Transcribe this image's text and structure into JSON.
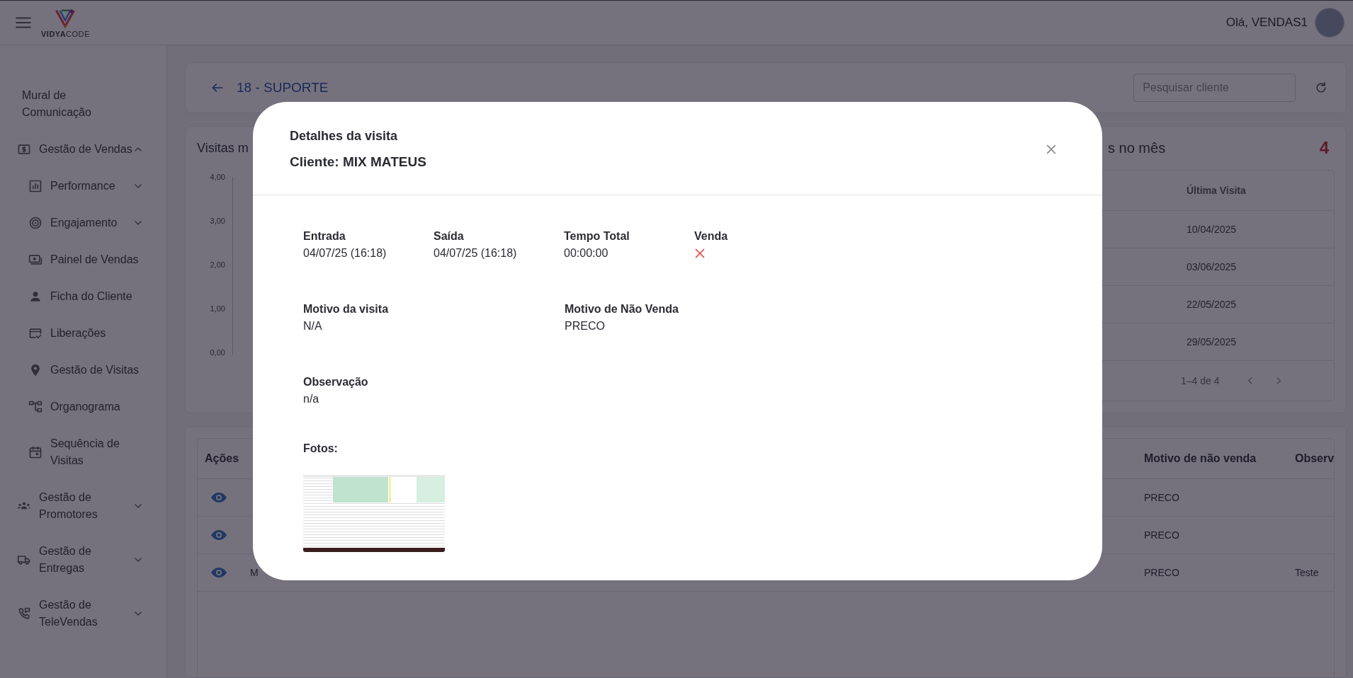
{
  "header": {
    "logo_text": "**VIDYA**CODE",
    "greeting": "Olá, VENDAS1"
  },
  "sidebar": {
    "items": [
      {
        "kind": "link",
        "label": "Mural de Comunicação"
      },
      {
        "kind": "group",
        "label": "Gestão de Vendas",
        "expanded": true,
        "children": [
          {
            "kind": "group",
            "label": "Performance",
            "expanded": false
          },
          {
            "kind": "group",
            "label": "Engajamento",
            "expanded": false
          },
          {
            "kind": "link",
            "label": "Painel de Vendas"
          },
          {
            "kind": "link",
            "label": "Ficha do Cliente"
          },
          {
            "kind": "link",
            "label": "Liberações"
          },
          {
            "kind": "link",
            "label": "Gestão de Visitas"
          },
          {
            "kind": "link",
            "label": "Organograma"
          },
          {
            "kind": "link",
            "label": "Sequência de Visitas"
          }
        ]
      },
      {
        "kind": "group",
        "label": "Gestão de Promotores",
        "expanded": false
      },
      {
        "kind": "group",
        "label": "Gestão de Entregas",
        "expanded": false
      },
      {
        "kind": "group",
        "label": "Gestão de TeleVendas",
        "expanded": false
      }
    ]
  },
  "page": {
    "title": "18 - SUPORTE",
    "search": {
      "placeholder": "Pesquisar cliente"
    }
  },
  "visits_card": {
    "chart_title": "Visitas m",
    "chart_yticks": [
      "4,00",
      "3,00",
      "2,00",
      "1,00",
      "0,00"
    ],
    "panel_title": "s no mês",
    "panel_count": "4",
    "table": {
      "columns": [
        "Última Visita"
      ],
      "rows": [
        [
          "10/04/2025"
        ],
        [
          "03/06/2025"
        ],
        [
          "22/05/2025"
        ],
        [
          "29/05/2025"
        ]
      ]
    },
    "pagination": "1–4 de 4"
  },
  "visits_table": {
    "columns": {
      "actions": "Ações",
      "reason": "Motivo de não venda",
      "note": "Observ"
    },
    "rows": [
      {
        "reason": "PRECO"
      },
      {
        "reason": "PRECO"
      },
      {
        "column_2": "M",
        "reason": "PRECO",
        "note": "Teste"
      }
    ]
  },
  "modal": {
    "title": "Detalhes da visita",
    "client": "Cliente: MIX MATEUS",
    "summary": [
      {
        "kind": "text",
        "label": "Entrada",
        "value": "04/07/25 (16:18)"
      },
      {
        "kind": "text",
        "label": "Saída",
        "value": "04/07/25 (16:18)"
      },
      {
        "kind": "text",
        "label": "Tempo Total",
        "value": "00:00:00"
      },
      {
        "kind": "flag",
        "label": "Venda",
        "value": false
      }
    ],
    "details": [
      {
        "label": "Motivo da visita",
        "value": "N/A"
      },
      {
        "label": "Motivo de Não Venda",
        "value": "PRECO"
      }
    ],
    "observation": {
      "label": "Observação",
      "value": "n/a"
    },
    "photos_label": "Fotos:"
  }
}
